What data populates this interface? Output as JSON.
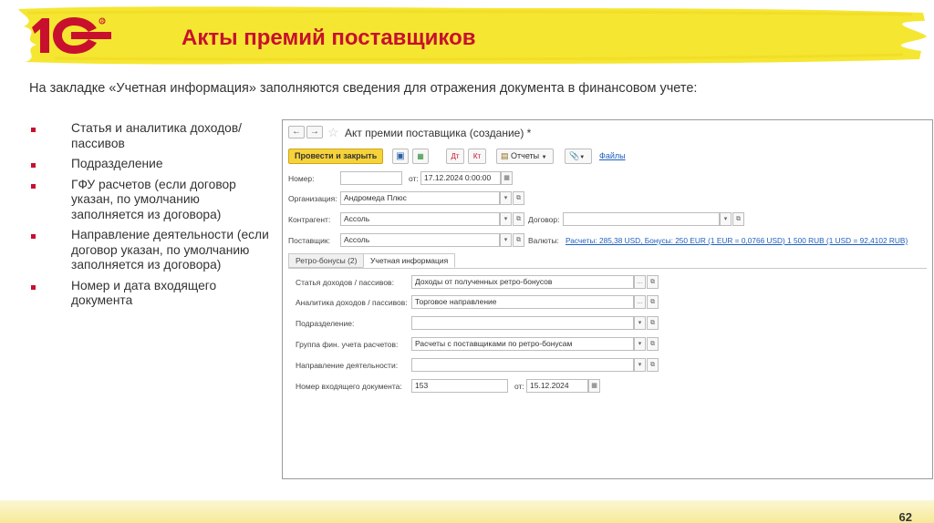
{
  "slide": {
    "title": "Акты премий поставщиков",
    "subtitle": "На закладке «Учетная информация» заполняются сведения для отражения документа в финансовом учете:",
    "page_number": "62",
    "accent_color": "#c8102e",
    "highlight_color": "#f5e632"
  },
  "logo": {
    "icon": "1c-logo-icon"
  },
  "bullets": [
    "Статья и аналитика доходов/пассивов",
    "Подразделение",
    "ГФУ расчетов (если договор указан, по умолчанию заполняется из договора)",
    "Направление деятельности (если договор указан, по умолчанию заполняется из договора)",
    "Номер и дата входящего документа"
  ],
  "window": {
    "title": "Акт премии поставщика (создание) *",
    "toolbar": {
      "post_close": "Провести и закрыть",
      "reports": "Отчеты",
      "files": "Файлы"
    },
    "header": {
      "number_label": "Номер:",
      "number_value": "",
      "date_label": "от:",
      "date_value": "17.12.2024  0:00:00",
      "org_label": "Организация:",
      "org_value": "Андромеда Плюс",
      "counterparty_label": "Контрагент:",
      "counterparty_value": "Ассоль",
      "contract_label": "Договор:",
      "contract_value": "",
      "supplier_label": "Поставщик:",
      "supplier_value": "Ассоль",
      "currency_label": "Валюты:",
      "currency_link": "Расчеты: 285,38 USD, Бонусы: 250 EUR (1 EUR = 0,0766 USD) 1 500 RUB (1 USD = 92,4102 RUB)"
    },
    "tabs": [
      "Ретро-бонусы (2)",
      "Учетная информация"
    ],
    "active_tab": 1,
    "accounting": {
      "income_item_label": "Статья доходов / пассивов:",
      "income_item_value": "Доходы от полученных ретро-бонусов",
      "income_analytics_label": "Аналитика доходов / пассивов:",
      "income_analytics_value": "Торговое направление",
      "department_label": "Подразделение:",
      "department_value": "",
      "fin_group_label": "Группа фин. учета расчетов:",
      "fin_group_value": "Расчеты с поставщиками по ретро-бонусам",
      "activity_label": "Направление деятельности:",
      "activity_value": "",
      "incoming_number_label": "Номер входящего документа:",
      "incoming_number_value": "153",
      "incoming_date_label": "от:",
      "incoming_date_value": "15.12.2024"
    }
  }
}
